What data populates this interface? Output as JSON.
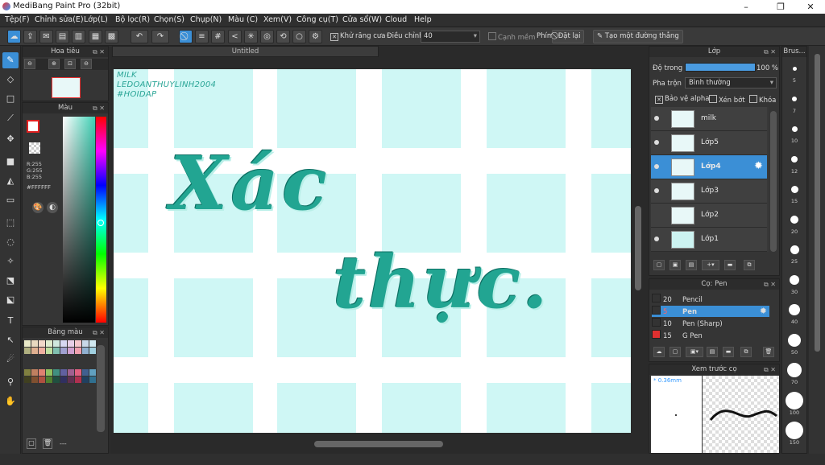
{
  "title": "MediBang Paint Pro (32bit)",
  "window_controls": {
    "minimize": "–",
    "restore": "❐",
    "close": "✕"
  },
  "menu": [
    "Tệp(F)",
    "Chỉnh sửa(E)",
    "Lớp(L)",
    "Bộ lọc(R)",
    "Chọn(S)",
    "Chụp(N)",
    "Màu (C)",
    "Xem(V)",
    "Công cụ(T)",
    "Cửa sổ(W)",
    "Cloud",
    "Help"
  ],
  "toolbar": {
    "antialias_label": "Khử răng cưa",
    "adjust_label": "Điều chỉnh",
    "adjust_value": "40",
    "soft_edge_label": "Cạnh mềm",
    "key_label": "Phím",
    "reset_label": "Đặt lại",
    "make_line_label": "Tạo một đường thẳng"
  },
  "navigator": {
    "title": "Hoa tiêu"
  },
  "color_panel": {
    "title": "Màu",
    "r": "R:255",
    "g": "G:255",
    "b": "B:255",
    "hex": "#FFFFFF"
  },
  "palette_panel": {
    "title": "Bảng màu",
    "status": "---"
  },
  "document": {
    "tab": "Untitled"
  },
  "canvas": {
    "watermark": [
      "MILK",
      "LEDOANTHUYLINH2004",
      "#HOIDAP"
    ],
    "lettering_line1": "Xác",
    "lettering_line2": "thực."
  },
  "layer_panel": {
    "title": "Lớp",
    "opacity_label": "Độ trong",
    "opacity_value": "100 %",
    "blend_label": "Pha trộn",
    "blend_value": "Bình thường",
    "protect_alpha": "Bảo vệ alpha",
    "clip": "Xén bớt",
    "lock": "Khóa",
    "layers": [
      {
        "name": "milk",
        "visible": true,
        "selected": false
      },
      {
        "name": "Lớp5",
        "visible": true,
        "selected": false
      },
      {
        "name": "Lớp4",
        "visible": true,
        "selected": true
      },
      {
        "name": "Lớp3",
        "visible": true,
        "selected": false
      },
      {
        "name": "Lớp2",
        "visible": false,
        "selected": false
      },
      {
        "name": "Lớp1",
        "visible": true,
        "selected": false
      }
    ]
  },
  "brush_panel": {
    "title": "Cọ: Pen",
    "brushes": [
      {
        "size": "20",
        "name": "Pencil",
        "color": "#333333",
        "selected": false
      },
      {
        "size": "5",
        "name": "Pen",
        "color": "#333333",
        "selected": true
      },
      {
        "size": "10",
        "name": "Pen (Sharp)",
        "color": "#333333",
        "selected": false
      },
      {
        "size": "15",
        "name": "G Pen",
        "color": "#e03030",
        "selected": false
      }
    ]
  },
  "preview_panel": {
    "title": "Xem trước cọ",
    "size": "* 0.36mm"
  },
  "brush_size_panel": {
    "title": "Brus...",
    "sizes": [
      "5",
      "7",
      "10",
      "12",
      "15",
      "20",
      "25",
      "30",
      "40",
      "50",
      "70",
      "100",
      "150"
    ]
  }
}
